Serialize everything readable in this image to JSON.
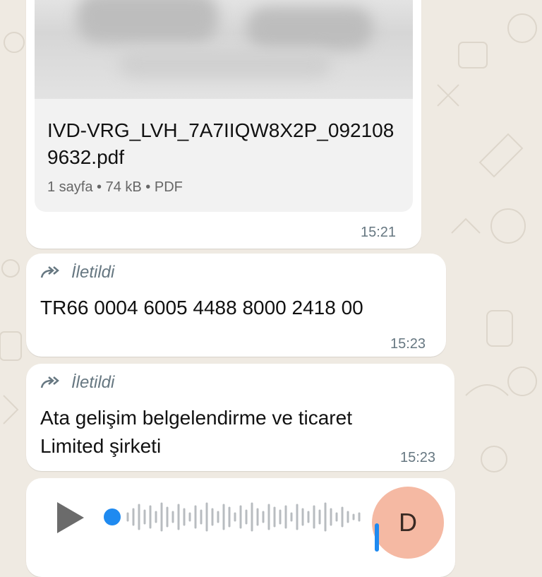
{
  "document_message": {
    "file_name": "IVD-VRG_LVH_7A7IIQW8X2P_0921089632.pdf",
    "meta": "1 sayfa • 74 kB • PDF",
    "time": "15:21"
  },
  "forwarded_message_1": {
    "forwarded_label": "İletildi",
    "text": "TR66 0004 6005 4488 8000 2418 00",
    "time": "15:23"
  },
  "forwarded_message_2": {
    "forwarded_label": "İletildi",
    "text_line1": "Ata gelişim belgelendirme ve ticaret",
    "text_line2": "Limited şirketi",
    "time": "15:23"
  },
  "voice_message": {
    "avatar_initial": "D",
    "progress": 0.0
  },
  "colors": {
    "chat_background": "#efeae2",
    "bubble": "#ffffff",
    "accent_blue": "#1f8af0",
    "avatar": "#f5b9a3"
  }
}
